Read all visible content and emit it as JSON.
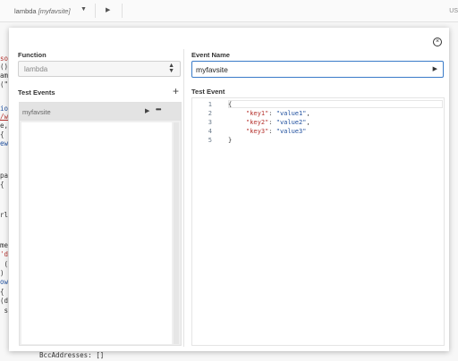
{
  "topbar": {
    "tab_name": "lambda",
    "tab_sub": "[myfavsite]",
    "dropdown_glyph": "▼",
    "run_glyph": "▶",
    "region": "US"
  },
  "editor_bg": {
    "lines": [
      "so",
      "()",
      "am",
      "(\"",
      "io",
      "/w",
      "e,",
      "{",
      "ew",
      "pa",
      "{",
      "rl",
      "me",
      "'d",
      " (",
      ")",
      "ow",
      "{",
      "(d",
      " s"
    ],
    "bottom_line": "BccAddresses: []"
  },
  "modal": {
    "close_glyph": "×",
    "function_label": "Function",
    "function_value": "lambda",
    "function_arrows": "▲▼",
    "test_events_label": "Test Events",
    "add_glyph": "+",
    "events": [
      {
        "name": "myfavsite",
        "play_glyph": "▶",
        "more_glyph": "•••"
      }
    ],
    "event_name_label": "Event Name",
    "event_name_value": "myfavsite",
    "run_glyph": "▶",
    "test_event_label": "Test Event",
    "code": {
      "line_numbers": [
        "1",
        "2",
        "3",
        "4",
        "5"
      ],
      "open_brace": "{",
      "close_brace": "}",
      "pairs": [
        {
          "key": "\"key1\"",
          "colon": ": ",
          "value": "\"value1\"",
          "comma": ","
        },
        {
          "key": "\"key2\"",
          "colon": ": ",
          "value": "\"value2\"",
          "comma": ","
        },
        {
          "key": "\"key3\"",
          "colon": ": ",
          "value": "\"value3\"",
          "comma": ""
        }
      ]
    }
  }
}
